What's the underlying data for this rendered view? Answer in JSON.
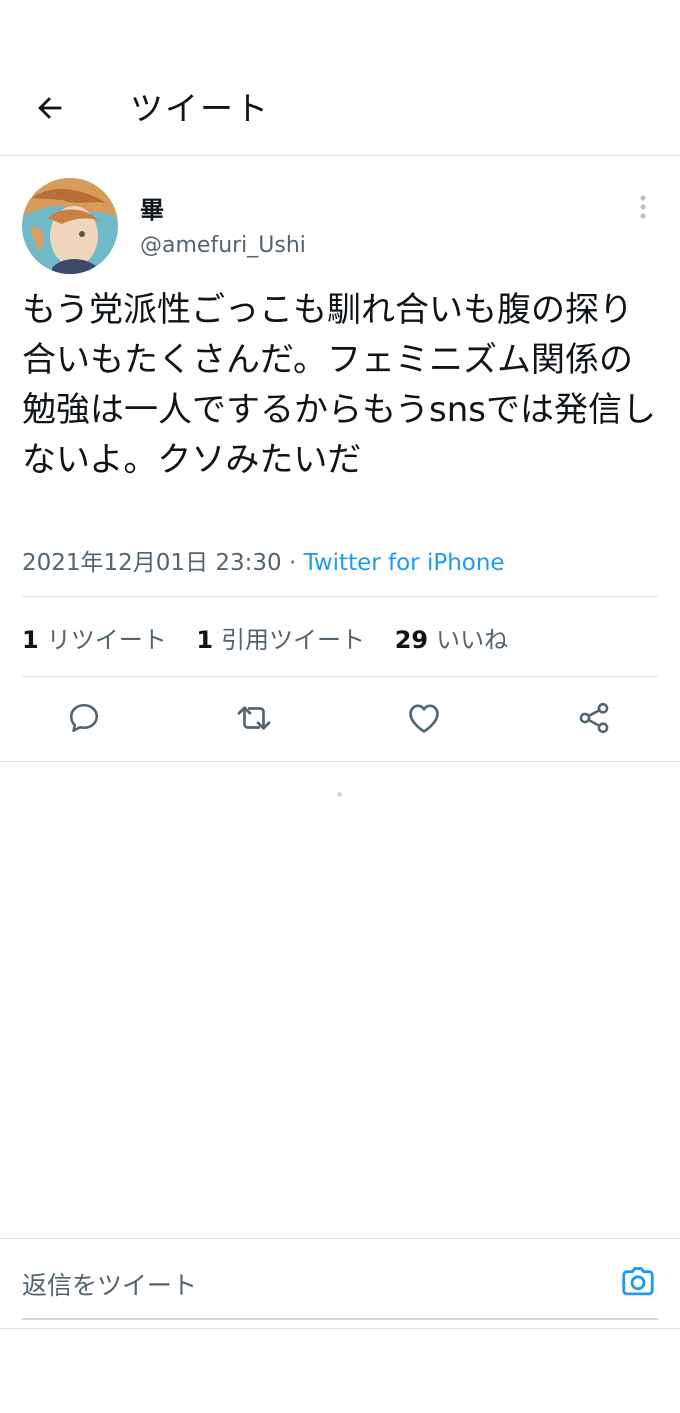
{
  "header": {
    "title": "ツイート"
  },
  "tweet": {
    "display_name": "畢",
    "handle": "@amefuri_Ushi",
    "text": "もう党派性ごっこも馴れ合いも腹の探り合いもたくさんだ。フェミニズム関係の勉強は一人でするからもうsnsでは発信しないよ。クソみたいだ",
    "timestamp": "2021年12月01日 23:30",
    "separator": "·",
    "source": "Twitter for iPhone"
  },
  "stats": [
    {
      "count": "1",
      "label": "リツイート"
    },
    {
      "count": "1",
      "label": "引用ツイート"
    },
    {
      "count": "29",
      "label": "いいね"
    }
  ],
  "reply": {
    "placeholder": "返信をツイート"
  },
  "colors": {
    "accent": "#1d9bf0",
    "secondary_text": "#536471",
    "divider": "#dfe3e6"
  }
}
